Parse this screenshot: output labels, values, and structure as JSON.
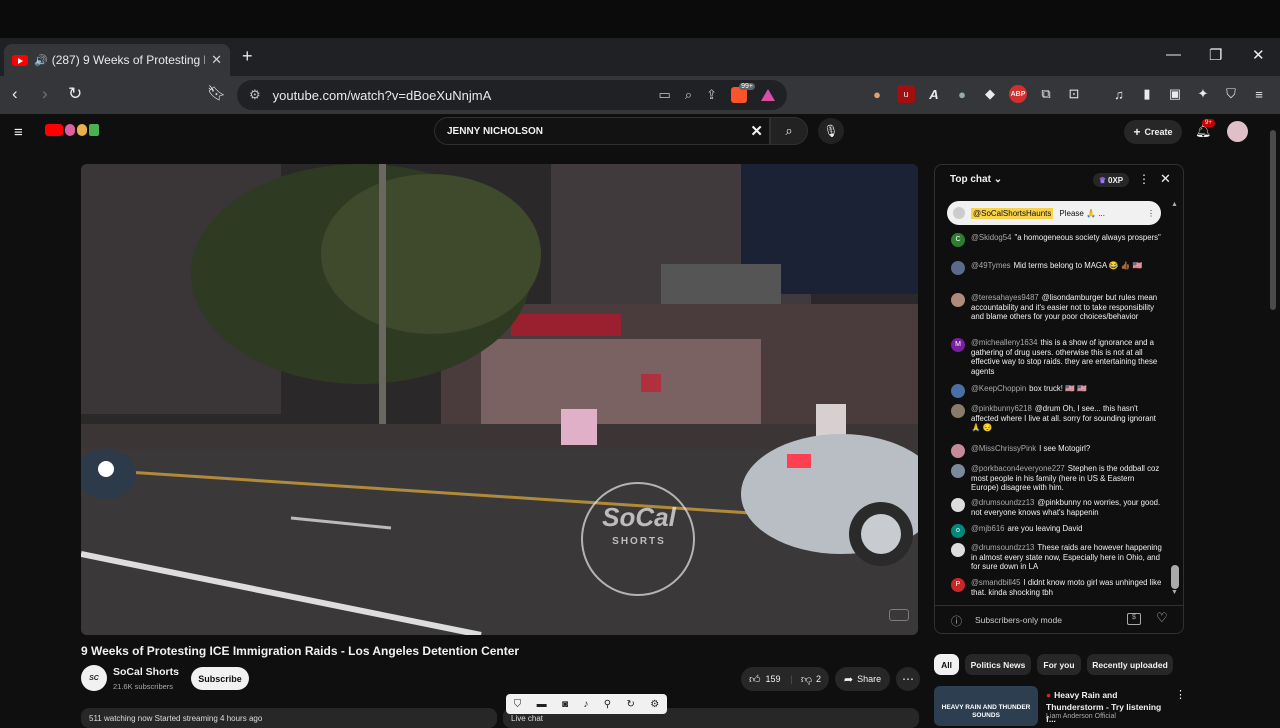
{
  "browser": {
    "tab_title": "(287) 9 Weeks of Protesting K",
    "new_tab": "+",
    "url": "youtube.com/watch?v=dBoeXuNnjmA",
    "brave_badge": "99+"
  },
  "youtube": {
    "search_value": "JENNY NICHOLSON",
    "create_label": "Create",
    "notification_count": "9+"
  },
  "video": {
    "title": "9 Weeks of Protesting ICE Immigration Raids - Los Angeles Detention Center",
    "channel_name": "SoCal Shorts",
    "subscribers": "21.6K subscribers",
    "subscribe_label": "Subscribe",
    "likes": "159",
    "dislikes": "2",
    "share_label": "Share",
    "watermark_line1": "SoCal",
    "watermark_line2": "SHORTS",
    "stream_info": "511 watching now  Started streaming 4 hours ago",
    "live_chat_label": "Live chat"
  },
  "chat": {
    "header": "Top chat",
    "xp": "0XP",
    "pinned_user": "@SoCalShortsHaunts",
    "pinned_text": "Please 🙏 ...",
    "messages": [
      {
        "user": "@Skidog54",
        "text": "\"a homogeneous society always prospers\"",
        "initial": "C",
        "color": "#2e7d32"
      },
      {
        "user": "@49Tymes",
        "text": "Mid terms belong to MAGA 😂 👍🏾 🇺🇸",
        "initial": "",
        "color": "#5a6a8a"
      },
      {
        "user": "@teresahayes9487",
        "text": "@lisondamburger but rules mean accountability and it's easier not to take responsibility and blame others for your poor choices/behavior",
        "initial": "",
        "color": "#b08a7a"
      },
      {
        "user": "@michealleny1634",
        "text": "this is a show of ignorance and a gathering of drug users. otherwise this is not at all effective way to stop raids. they are entertaining these agents",
        "initial": "M",
        "color": "#7b1fa2"
      },
      {
        "user": "@KeepChoppin",
        "text": "box truck! 🇺🇸 🇺🇸",
        "initial": "",
        "color": "#4a6fa5"
      },
      {
        "user": "@pinkbunny6218",
        "text": "@drum Oh, I see... this hasn't affected where I live at all. sorry for sounding ignorant 🙏 😔",
        "initial": "",
        "color": "#8a7a6a"
      },
      {
        "user": "@MissChrissyPink",
        "text": "I see Motogirl?",
        "initial": "",
        "color": "#c48a9a"
      },
      {
        "user": "@porkbacon4everyone227",
        "text": "Stephen is the oddball coz most people in his family (here in US & Eastern Europe) disagree with him.",
        "initial": "",
        "color": "#7a8a9a"
      },
      {
        "user": "@drumsoundzz13",
        "text": "@pinkbunny no worries, your good. not everyone knows what's happenin",
        "initial": "",
        "color": "#dddddd"
      },
      {
        "user": "@mjb616",
        "text": "are you leaving David",
        "initial": "o",
        "color": "#00897b"
      },
      {
        "user": "@drumsoundzz13",
        "text": "These raids are however happening in almost every state now, Especially here in Ohio, and for sure down in LA",
        "initial": "",
        "color": "#dddddd"
      },
      {
        "user": "@smandbill45",
        "text": "I didnt know moto girl was unhinged like that. kinda shocking tbh",
        "initial": "P",
        "color": "#c62828"
      }
    ],
    "footer": "Subscribers-only mode"
  },
  "recommendations": {
    "chips": [
      "All",
      "Politics News",
      "For you",
      "Recently uploaded"
    ],
    "first_title": "Heavy Rain and Thunderstorm - Try listening f...",
    "first_channel": "Liam Anderson Official",
    "first_thumb_text": "HEAVY RAIN AND THUNDER SOUNDS"
  }
}
